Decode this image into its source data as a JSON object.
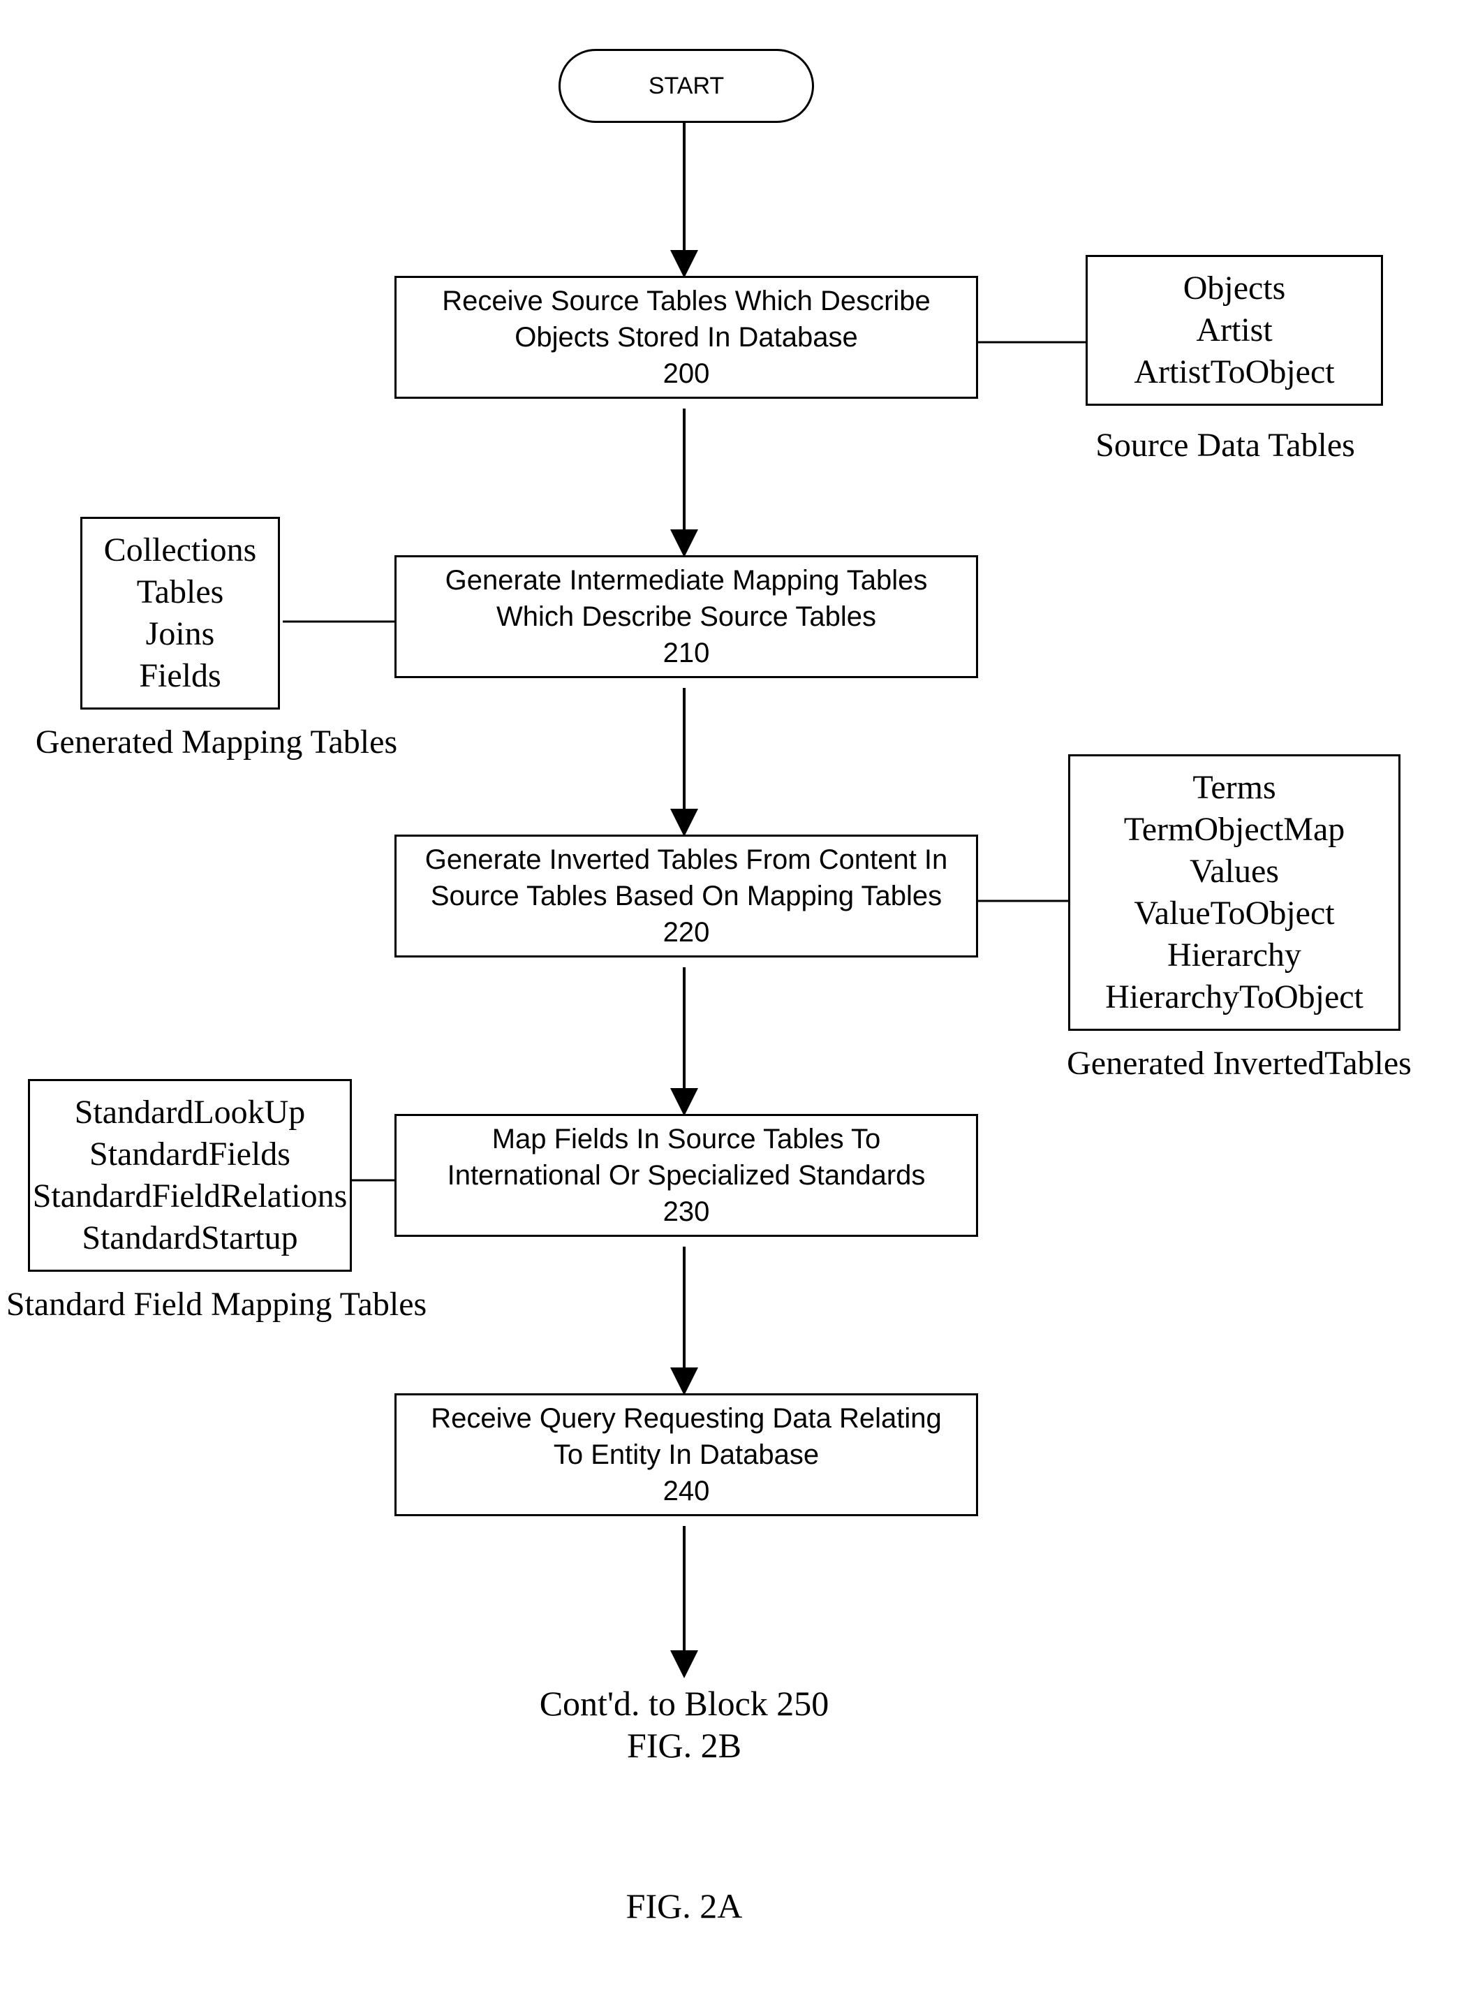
{
  "start": {
    "label": "START"
  },
  "steps": {
    "s200": {
      "line1": "Receive Source Tables Which Describe",
      "line2": "Objects Stored In Database",
      "num": "200"
    },
    "s210": {
      "line1": "Generate Intermediate Mapping Tables",
      "line2": "Which Describe Source Tables",
      "num": "210"
    },
    "s220": {
      "line1": "Generate Inverted Tables From Content In",
      "line2": "Source Tables Based On Mapping Tables",
      "num": "220"
    },
    "s230": {
      "line1": "Map Fields In Source Tables To",
      "line2": "International Or Specialized Standards",
      "num": "230"
    },
    "s240": {
      "line1": "Receive Query Requesting Data Relating",
      "line2": "To Entity In Database",
      "num": "240"
    }
  },
  "side": {
    "source_data": {
      "l1": "Objects",
      "l2": "Artist",
      "l3": "ArtistToObject",
      "caption": "Source Data Tables"
    },
    "mapping": {
      "l1": "Collections",
      "l2": "Tables",
      "l3": "Joins",
      "l4": "Fields",
      "caption": "Generated Mapping Tables"
    },
    "inverted": {
      "l1": "Terms",
      "l2": "TermObjectMap",
      "l3": "Values",
      "l4": "ValueToObject",
      "l5": "Hierarchy",
      "l6": "HierarchyToObject",
      "caption": "Generated InvertedTables"
    },
    "standard": {
      "l1": "StandardLookUp",
      "l2": "StandardFields",
      "l3": "StandardFieldRelations",
      "l4": "StandardStartup",
      "caption": "Standard Field Mapping Tables"
    }
  },
  "footer": {
    "contd": "Cont'd. to Block 250",
    "figb": "FIG. 2B",
    "figa": "FIG. 2A"
  }
}
